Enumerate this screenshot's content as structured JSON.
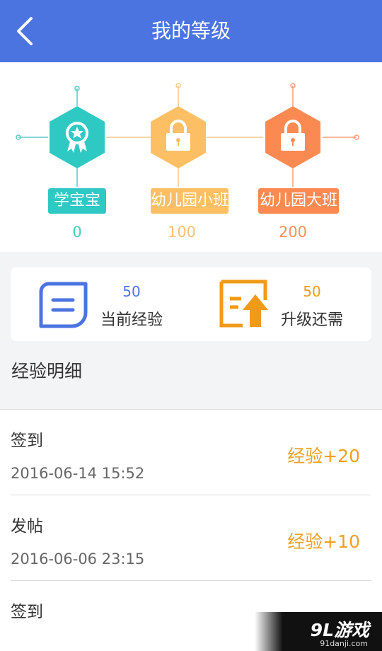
{
  "header": {
    "title": "我的等级"
  },
  "levels": [
    {
      "name": "学宝宝",
      "score": "0",
      "color": "#2fc9c4",
      "score_color": "#4fc9c0",
      "icon": "badge-icon",
      "locked": false
    },
    {
      "name": "幼儿园小班",
      "score": "100",
      "color": "#fdbf63",
      "score_color": "#fdc079",
      "icon": "lock-icon",
      "locked": true
    },
    {
      "name": "幼儿园大班",
      "score": "200",
      "color": "#fb8a52",
      "score_color": "#fb9060",
      "icon": "lock-icon",
      "locked": true
    }
  ],
  "stats": {
    "current": {
      "value": "50",
      "label": "当前经验",
      "color": "#4c74e0",
      "icon": "note-icon"
    },
    "upgrade": {
      "value": "50",
      "label": "升级还需",
      "color": "#f09a1a",
      "icon": "upgrade-arrow-icon"
    }
  },
  "detail_title": "经验明细",
  "records": [
    {
      "action": "签到",
      "time": "2016-06-14 15:52",
      "gain": "经验+20"
    },
    {
      "action": "发帖",
      "time": "2016-06-06 23:15",
      "gain": "经验+10"
    },
    {
      "action": "签到",
      "time": "",
      "gain": ""
    }
  ],
  "watermark": {
    "logo": "9L游戏",
    "url": "91danji.com"
  }
}
